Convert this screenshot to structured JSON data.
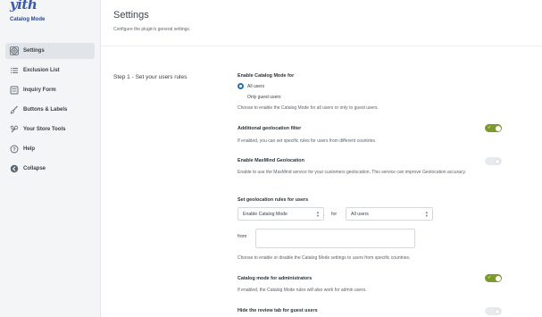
{
  "brand": {
    "logo": "yith",
    "subtitle": "Catalog Mode"
  },
  "sidebar": {
    "items": [
      {
        "label": "Settings",
        "icon": "gear-icon"
      },
      {
        "label": "Exclusion List",
        "icon": "list-icon"
      },
      {
        "label": "Inquiry Form",
        "icon": "form-icon"
      },
      {
        "label": "Buttons & Labels",
        "icon": "brush-icon"
      },
      {
        "label": "Your Store Tools",
        "icon": "tools-icon"
      },
      {
        "label": "Help",
        "icon": "help-icon"
      },
      {
        "label": "Collapse",
        "icon": "collapse-icon"
      }
    ]
  },
  "page": {
    "title": "Settings",
    "description": "Configure the plugin's general settings."
  },
  "section": {
    "title": "Step 1 - Set your users rules"
  },
  "settings": {
    "enable_for": {
      "label": "Enable Catalog Mode for",
      "options": [
        "All users",
        "Only guest users"
      ],
      "selected": "All users",
      "description": "Choose to enable the Catalog Mode for all users or only to guest users."
    },
    "geolocation_filter": {
      "label": "Additional geolocation filter",
      "description": "If enabled, you can set specific rules for users from different countries.",
      "enabled": true
    },
    "maxmind": {
      "label": "Enable MaxMind Geolocation",
      "description": "Enable to use the MaxMind service for your customers geolocation. This service can improve Geolocation accuracy.",
      "enabled": false
    },
    "geo_rules": {
      "label": "Set geolocation rules for users",
      "action_value": "Enable Catalog Mode",
      "for_label": "for",
      "users_value": "All users",
      "from_label": "from",
      "from_value": "",
      "description": "Choose to enable or disable the Catalog Mode settings to users from specific countries."
    },
    "admins": {
      "label": "Catalog mode for administrators",
      "description": "If enabled, the Catalog Mode rules will also work for admin users.",
      "enabled": true
    },
    "review_tab": {
      "label": "Hide the review tab for guest users",
      "enabled": false
    }
  },
  "colors": {
    "toggle_on": "#7c9a2e",
    "radio_accent": "#2271b1",
    "brand": "#3c5ba6"
  }
}
